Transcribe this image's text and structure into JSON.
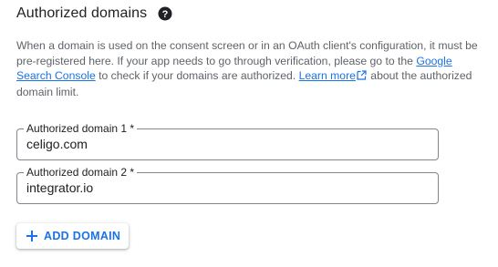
{
  "section": {
    "title": "Authorized domains",
    "help_icon": "help-circle-icon"
  },
  "description": {
    "text_before": "When a domain is used on the consent screen or in an OAuth client's configuration, it must be pre-registered here. If your app needs to go through verification, please go to the ",
    "link_search_console": "Google Search Console",
    "text_middle": " to check if your domains are authorized. ",
    "link_learn_more": "Learn more",
    "learn_more_icon": "open-in-new-icon",
    "text_after": " about the authorized domain limit."
  },
  "fields": [
    {
      "label": "Authorized domain 1 *",
      "value": "celigo.com"
    },
    {
      "label": "Authorized domain 2 *",
      "value": "integrator.io"
    }
  ],
  "add_button": {
    "label": "ADD DOMAIN",
    "icon": "plus-icon"
  },
  "colors": {
    "link": "#1a73e8",
    "text": "#202124",
    "secondary_text": "#5f6368",
    "border": "#80868b"
  }
}
